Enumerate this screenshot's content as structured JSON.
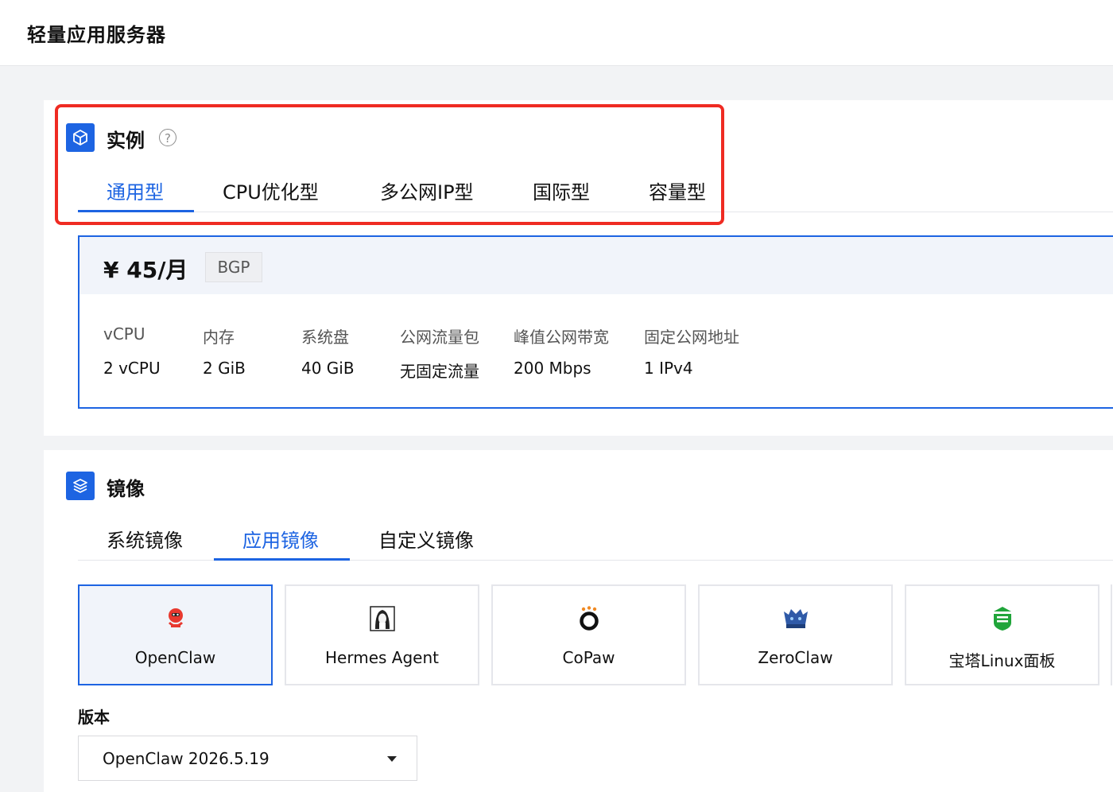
{
  "header": {
    "title": "轻量应用服务器"
  },
  "instance": {
    "section_title": "实例",
    "help_icon": "question-circle-icon",
    "tabs": [
      {
        "label": "通用型",
        "active": true
      },
      {
        "label": "CPU优化型",
        "active": false
      },
      {
        "label": "多公网IP型",
        "active": false
      },
      {
        "label": "国际型",
        "active": false
      },
      {
        "label": "容量型",
        "active": false
      }
    ],
    "plan": {
      "price": "¥ 45/月",
      "badge": "BGP",
      "specs": [
        {
          "label": "vCPU",
          "value": "2 vCPU"
        },
        {
          "label": "内存",
          "value": "2 GiB"
        },
        {
          "label": "系统盘",
          "value": "40 GiB"
        },
        {
          "label": "公网流量包",
          "value": "无固定流量"
        },
        {
          "label": "峰值公网带宽",
          "value": "200 Mbps"
        },
        {
          "label": "固定公网地址",
          "value": "1 IPv4"
        }
      ]
    }
  },
  "image": {
    "section_title": "镜像",
    "tabs": [
      {
        "label": "系统镜像",
        "active": false
      },
      {
        "label": "应用镜像",
        "active": true
      },
      {
        "label": "自定义镜像",
        "active": false
      }
    ],
    "cards": [
      {
        "name": "OpenClaw",
        "icon": "openclaw-logo-icon",
        "selected": true
      },
      {
        "name": "Hermes Agent",
        "icon": "hermes-agent-logo-icon",
        "selected": false
      },
      {
        "name": "CoPaw",
        "icon": "copaw-logo-icon",
        "selected": false
      },
      {
        "name": "ZeroClaw",
        "icon": "zeroclaw-logo-icon",
        "selected": false
      },
      {
        "name": "宝塔Linux面板",
        "icon": "baota-logo-icon",
        "selected": false
      }
    ],
    "version_label": "版本",
    "version_value": "OpenClaw 2026.5.19"
  },
  "colors": {
    "accent": "#1d64e2",
    "highlight": "#ef2b22",
    "selected_bg": "#f1f4fa"
  }
}
